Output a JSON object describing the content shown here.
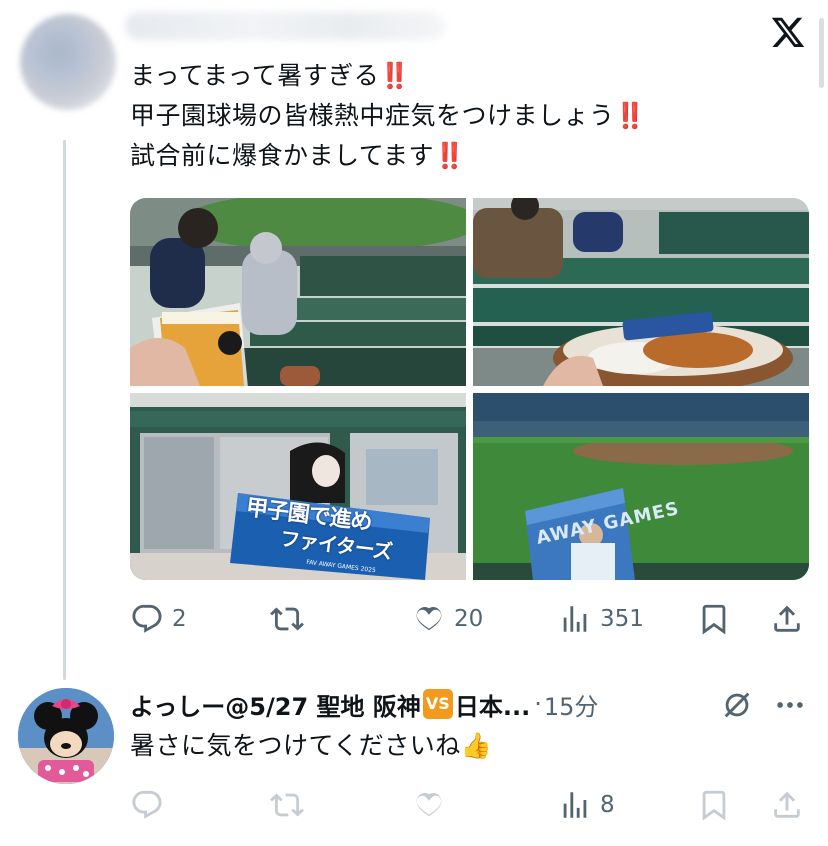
{
  "tweet": {
    "lines": [
      "まってまって暑すぎる",
      "甲子園球場の皆様熱中症気をつけましょう",
      "試合前に爆食かましてます"
    ],
    "emphasis": "‼️",
    "media_count": 4,
    "actions": {
      "reply_count": "2",
      "retweet_count": "",
      "like_count": "20",
      "view_count": "351"
    }
  },
  "media": {
    "banner_text_1": "甲子園で進め",
    "banner_text_2": "ファイターズ",
    "banner_small": "FAV AWAY GAMES 2025",
    "poster_text": "AWAY GAMES"
  },
  "reply": {
    "name": "よっしー@5/27 聖地 阪神",
    "vs_badge": "VS",
    "name_tail": "日本...",
    "separator": "·",
    "time": "15分",
    "text": "暑さに気をつけてくださいね👍",
    "view_count": "8"
  },
  "colors": {
    "emphasis_red": "#e0262a",
    "muted_gray": "#536471",
    "thread_line": "#cfd9de",
    "vs_orange": "#f29a1e"
  },
  "icons": [
    "x-logo-icon",
    "reply-icon",
    "retweet-icon",
    "like-icon",
    "views-icon",
    "bookmark-icon",
    "share-icon",
    "mute-icon",
    "more-icon"
  ]
}
